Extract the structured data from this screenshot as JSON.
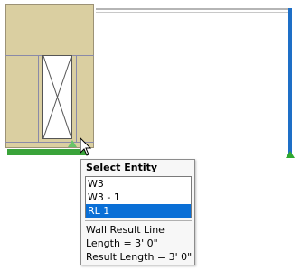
{
  "popup": {
    "title": "Select Entity",
    "items": [
      {
        "label": "W3",
        "selected": false
      },
      {
        "label": "W3 - 1",
        "selected": false
      },
      {
        "label": "RL 1",
        "selected": true
      }
    ],
    "info": {
      "type": "Wall Result Line",
      "length": "Length = 3' 0\"",
      "result_length": "Result Length = 3' 0\""
    }
  },
  "colors": {
    "wall_fill": "#dacfa1",
    "selection_blue": "#0a6fd6",
    "result_line_green": "#3aa33a",
    "post_blue": "#1e6fc7"
  }
}
